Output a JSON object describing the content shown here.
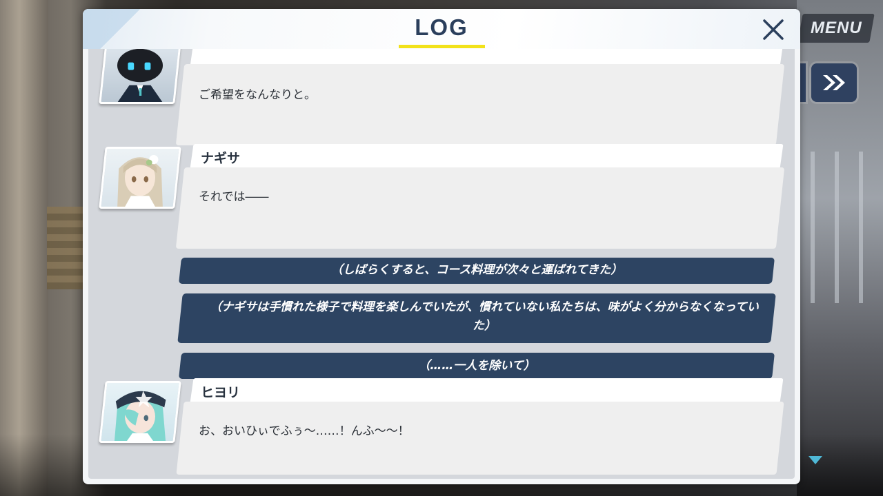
{
  "window": {
    "title": "LOG"
  },
  "hud": {
    "menu_label": "MENU",
    "skip_icon": "fast-forward-icon",
    "close_icon": "close-x-icon",
    "scroll_icon": "scroll-down-icon"
  },
  "colors": {
    "title": "#2b3f5c",
    "underline": "#f2e21a",
    "narration_bg": "#2d4462",
    "accent": "#4fb8d6"
  },
  "log": {
    "entries": [
      {
        "type": "dialogue",
        "speaker": "",
        "text": "ご希望をなんなりと。",
        "avatar": "robot-butler-portrait"
      },
      {
        "type": "dialogue",
        "speaker": "ナギサ",
        "text": "それでは――",
        "avatar": "nagisa-portrait"
      },
      {
        "type": "narration",
        "text": "（しばらくすると、コース料理が次々と運ばれてきた）"
      },
      {
        "type": "narration",
        "text": "（ナギサは手慣れた様子で料理を楽しんでいたが、慣れていない私たちは、味がよく分からなくなっていた）"
      },
      {
        "type": "narration",
        "text": "（……一人を除いて）"
      },
      {
        "type": "dialogue",
        "speaker": "ヒヨリ",
        "text": "お、おいひぃでふぅ～……！んふ～～！",
        "avatar": "hiyori-portrait"
      }
    ]
  }
}
